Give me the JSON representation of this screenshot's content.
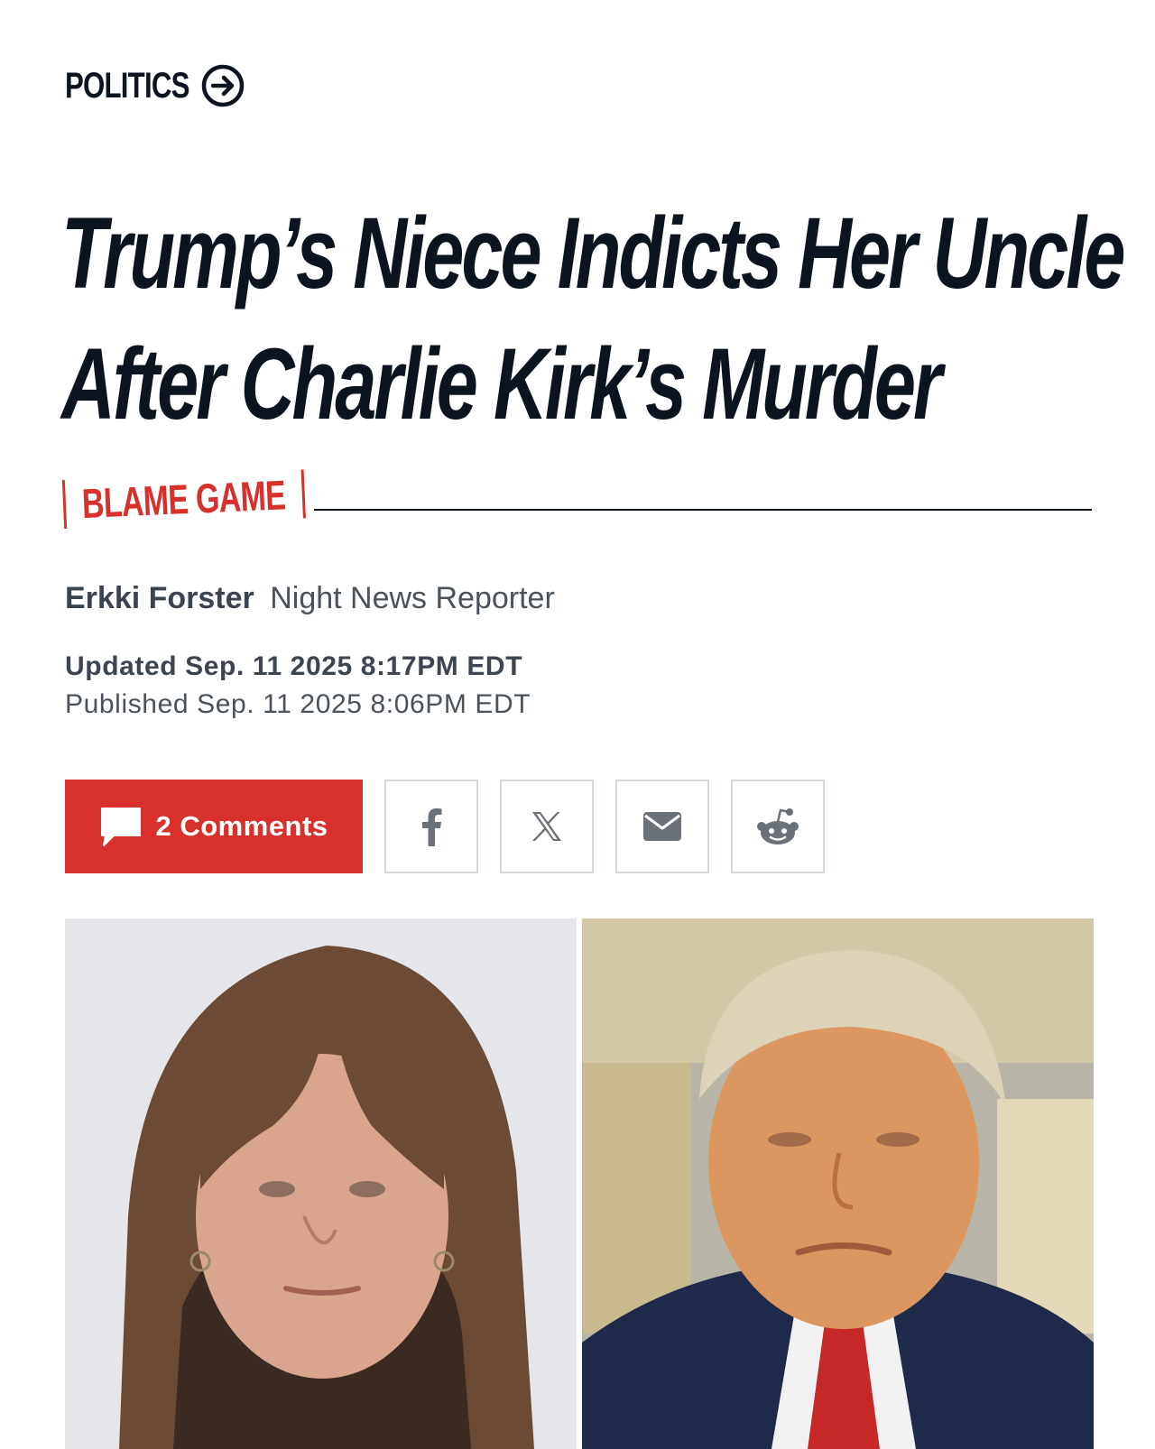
{
  "section": {
    "label": "POLITICS",
    "icon": "arrow-right-circle-icon"
  },
  "headline": {
    "line1": "Trump’s Niece Indicts Her Uncle",
    "line2": "After Charlie Kirk’s Murder"
  },
  "kicker": "BLAME GAME",
  "byline": {
    "author": "Erkki Forster",
    "role": "Night News Reporter"
  },
  "timestamps": {
    "updated": "Updated Sep. 11 2025 8:17PM EDT",
    "published": "Published Sep. 11 2025 8:06PM EDT"
  },
  "share": {
    "comments_label": "2 Comments",
    "comments_icon": "speech-bubble-icon",
    "buttons": [
      {
        "name": "facebook",
        "icon": "facebook-icon"
      },
      {
        "name": "x",
        "icon": "x-icon"
      },
      {
        "name": "email",
        "icon": "envelope-icon"
      },
      {
        "name": "reddit",
        "icon": "reddit-icon"
      }
    ]
  },
  "colors": {
    "accent": "#d8302a",
    "headline": "#0c151f",
    "meta": "#3c4550",
    "border": "#d4d6d9"
  }
}
